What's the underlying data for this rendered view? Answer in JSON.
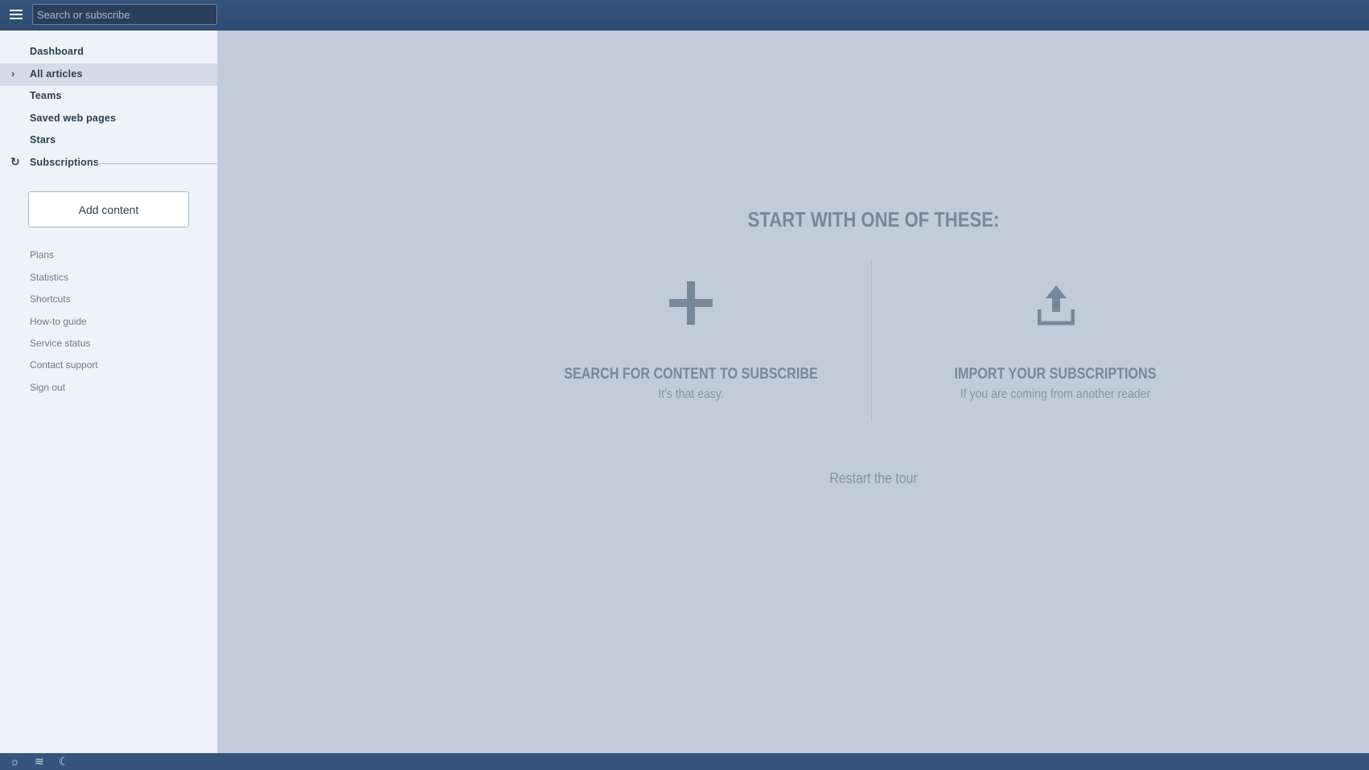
{
  "search": {
    "placeholder": "Search or subscribe"
  },
  "sidebar": {
    "nav": [
      {
        "label": "Dashboard"
      },
      {
        "label": "All articles"
      },
      {
        "label": "Teams"
      },
      {
        "label": "Saved web pages"
      },
      {
        "label": "Stars"
      },
      {
        "label": "Subscriptions"
      }
    ],
    "add_button": "Add content",
    "links": [
      "Plans",
      "Statistics",
      "Shortcuts",
      "How-to guide",
      "Service status",
      "Contact support",
      "Sign out"
    ]
  },
  "main": {
    "heading": "START WITH ONE OF THESE:",
    "options": [
      {
        "title": "SEARCH FOR CONTENT TO SUBSCRIBE",
        "subtitle": "It's that easy.",
        "icon": "plus-icon"
      },
      {
        "title": "IMPORT YOUR SUBSCRIPTIONS",
        "subtitle": "If you are coming from another reader",
        "icon": "upload-icon"
      }
    ],
    "restart": "Restart the tour"
  },
  "bottombar": {
    "icons": [
      "sun-icon",
      "wave-icon",
      "moon-icon"
    ]
  }
}
